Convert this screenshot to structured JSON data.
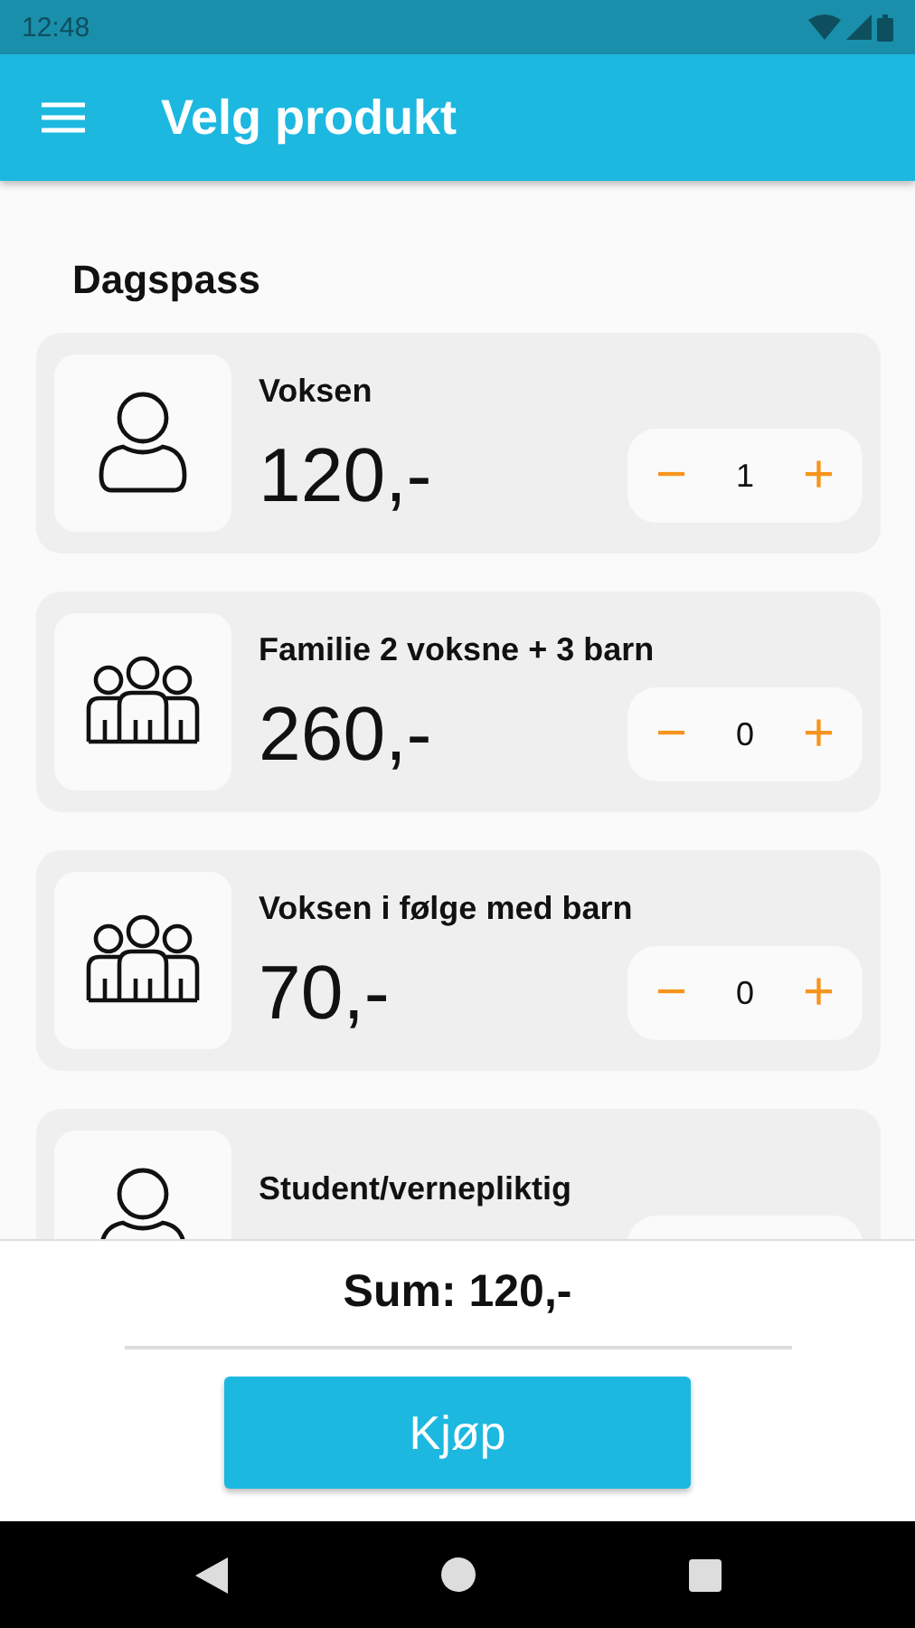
{
  "status_bar": {
    "time": "12:48"
  },
  "app_bar": {
    "title": "Velg produkt"
  },
  "section": {
    "title": "Dagspass"
  },
  "products": [
    {
      "kind": "single",
      "name": "Voksen",
      "price": "120,-",
      "quantity": "1"
    },
    {
      "kind": "group",
      "name": "Familie 2 voksne + 3 barn",
      "price": "260,-",
      "quantity": "0"
    },
    {
      "kind": "group",
      "name": "Voksen i følge med barn",
      "price": "70,-",
      "quantity": "0"
    },
    {
      "kind": "single",
      "name": "Student/vernepliktig"
    }
  ],
  "steppers": {
    "minus": "−",
    "plus": "+"
  },
  "summary": {
    "sum": "Sum: 120,-",
    "button": "Kjøp"
  }
}
